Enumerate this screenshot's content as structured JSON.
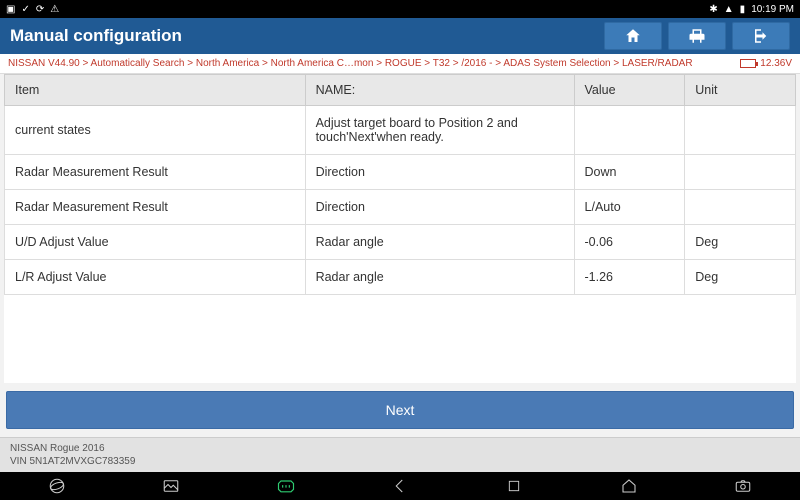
{
  "status": {
    "time": "10:19 PM"
  },
  "titlebar": {
    "title": "Manual configuration"
  },
  "breadcrumb": {
    "path": "NISSAN V44.90 > Automatically Search > North America > North America C…mon > ROGUE > T32 > /2016 - > ADAS System Selection > LASER/RADAR",
    "voltage": "12.36V"
  },
  "table": {
    "headers": {
      "item": "Item",
      "name": "NAME:",
      "value": "Value",
      "unit": "Unit"
    },
    "rows": [
      {
        "item": "current states",
        "name": "Adjust target board to Position 2 and touch'Next'when ready.",
        "value": "",
        "unit": ""
      },
      {
        "item": "Radar Measurement Result",
        "name": "Direction",
        "value": "Down",
        "unit": ""
      },
      {
        "item": "Radar Measurement Result",
        "name": "Direction",
        "value": "L/Auto",
        "unit": ""
      },
      {
        "item": "U/D Adjust Value",
        "name": "Radar angle",
        "value": "-0.06",
        "unit": "Deg"
      },
      {
        "item": "L/R Adjust Value",
        "name": "Radar angle",
        "value": "-1.26",
        "unit": "Deg"
      }
    ]
  },
  "next_button": "Next",
  "footer": {
    "vehicle": "NISSAN Rogue 2016",
    "vin": "VIN 5N1AT2MVXGC783359"
  }
}
